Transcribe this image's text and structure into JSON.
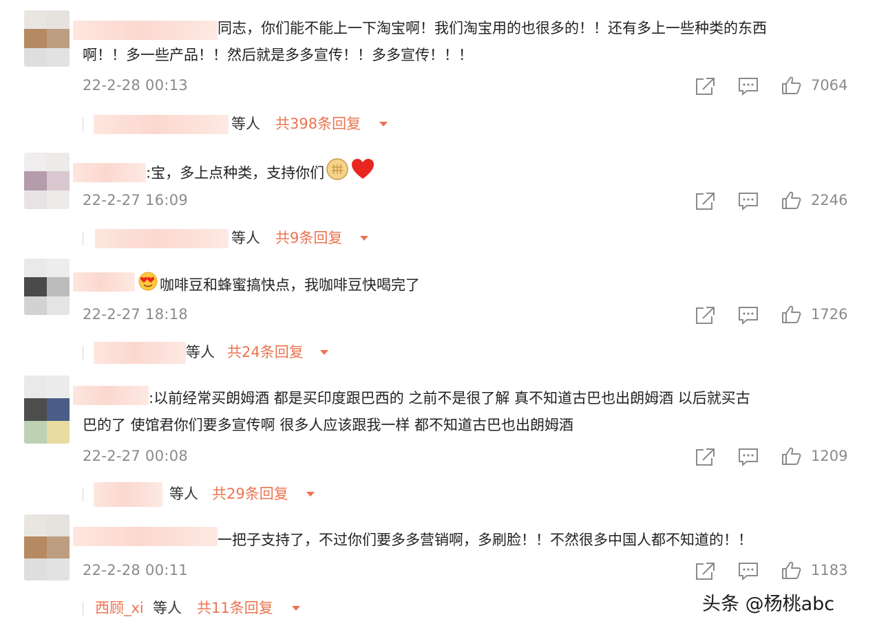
{
  "comments": [
    {
      "text_lines": [
        "同志，你们能不能上一下淘宝啊！我们淘宝用的也很多的！！还有多上一些种类的东西",
        "啊！！多一些产品！！然后就是多多宣传！！多多宣传！！！"
      ],
      "time": "22-2-28 00:13",
      "likes": "7064",
      "reply_label": "等人",
      "reply_count": "共398条回复"
    },
    {
      "text_lines": [
        ":宝，多上点种类，支持你们"
      ],
      "emoji": [
        "fist-icon",
        "red-heart-icon"
      ],
      "time": "22-2-27 16:09",
      "likes": "2246",
      "reply_label": "等人",
      "reply_count": "共9条回复"
    },
    {
      "text_lines": [
        "咖啡豆和蜂蜜搞快点，我咖啡豆快喝完了"
      ],
      "emoji": [
        "heart-eyes-icon"
      ],
      "time": "22-2-27 18:18",
      "likes": "1726",
      "reply_label": "等人",
      "reply_count": "共24条回复"
    },
    {
      "text_lines": [
        ":以前经常买朗姆酒 都是买印度跟巴西的 之前不是很了解 真不知道古巴也出朗姆酒 以后就买古",
        "巴的了 使馆君你们要多宣传啊 很多人应该跟我一样 都不知道古巴也出朗姆酒"
      ],
      "time": "22-2-27 00:08",
      "likes": "1209",
      "reply_label": "等人",
      "reply_count": "共29条回复"
    },
    {
      "text_lines": [
        "一把子支持了，不过你们要多多营销啊，多刷脸！！不然很多中国人都不知道的！！"
      ],
      "time": "22-2-28 00:11",
      "likes": "1183",
      "reply_name": "西顾_xi",
      "reply_label": "等人",
      "reply_count": "共11条回复"
    }
  ],
  "icons": {
    "share": "share-icon",
    "comment": "comment-icon",
    "like": "thumbs-up-icon",
    "expand": "caret-down-icon"
  },
  "colors": {
    "accent": "#eb7350",
    "muted": "#8a8a8a",
    "text": "#222222"
  },
  "watermark": "头条 @杨桃abc"
}
